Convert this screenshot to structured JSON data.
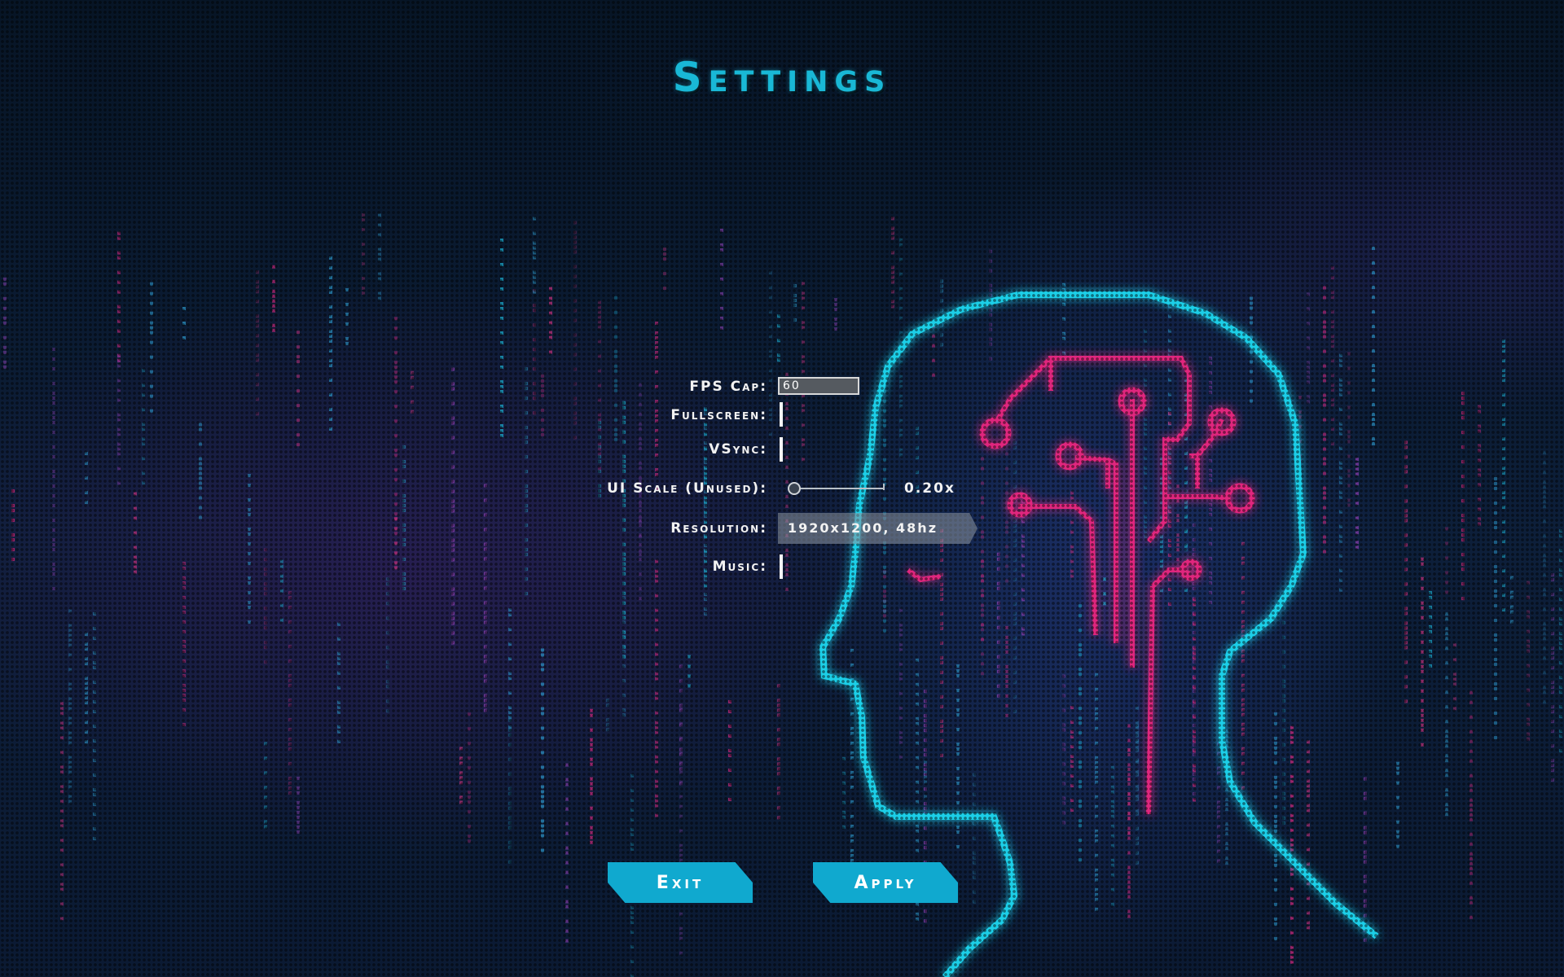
{
  "screen": {
    "title": "Settings"
  },
  "settings": {
    "fps_cap": {
      "label": "FPS Cap:",
      "value": "60"
    },
    "fullscreen": {
      "label": "Fullscreen:",
      "checked": false
    },
    "vsync": {
      "label": "VSync:",
      "checked": false
    },
    "ui_scale": {
      "label": "UI Scale (Unused):",
      "value": 0.2,
      "value_text": "0.20x"
    },
    "resolution": {
      "label": "Resolution:",
      "selected": "1920x1200, 48hz"
    },
    "music": {
      "label": "Music:",
      "checked": false
    }
  },
  "buttons": {
    "exit": "Exit",
    "apply": "Apply"
  },
  "colors": {
    "accent_cyan": "#10a9cf",
    "title_cyan": "#19b8d6",
    "neon_head_outline": "#1ecfe8",
    "neon_circuit_pink": "#e0287e",
    "background": "#0a1a2e"
  },
  "icons": {
    "background_art": "cyber-head-circuit-icon"
  }
}
